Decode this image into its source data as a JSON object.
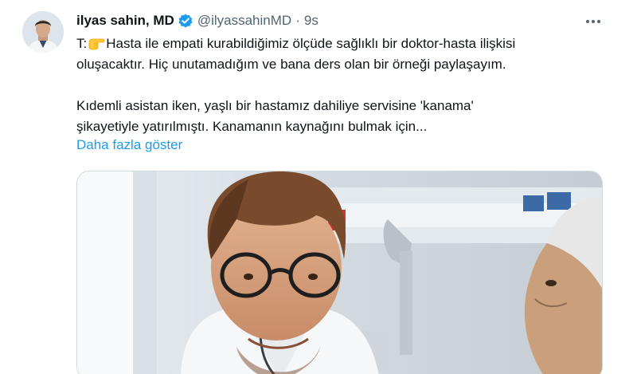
{
  "tweet": {
    "author_name": "ilyas sahin, MD",
    "handle": "@ilyassahinMD",
    "separator": "·",
    "time": "9s",
    "text_prefix": "T:",
    "line1": "Hasta ile empati kurabildiğimiz ölçüde sağlıklı bir doktor-hasta ilişkisi",
    "line2": "oluşacaktır. Hiç unutamadığım ve bana ders olan bir örneği paylaşayım.",
    "line3": "Kıdemli asistan iken, yaşlı bir hastamız dahiliye servisine 'kanama'",
    "line4": "şikayetiyle yatırılmıştı. Kanamanın kaynağını bulmak için...",
    "show_more": "Daha fazla göster"
  },
  "icons": {
    "avatar": "author-avatar",
    "verified": "verified-badge-icon",
    "more": "more-options-icon",
    "emoji": "pointing-right-emoji-icon"
  },
  "colors": {
    "link": "#1d9bf0",
    "secondary_text": "#536471",
    "primary_text": "#0f1419",
    "verified": "#1d9bf0"
  }
}
